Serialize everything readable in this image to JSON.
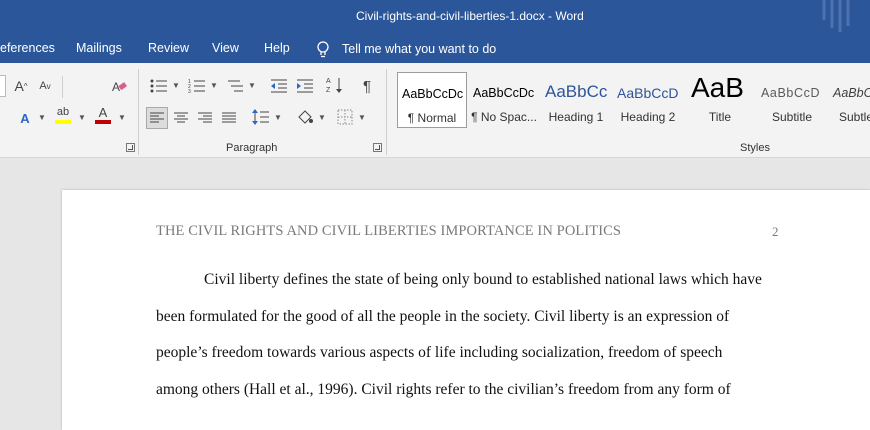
{
  "window": {
    "title": "Civil-rights-and-civil-liberties-1.docx  -  Word"
  },
  "menu": {
    "items": [
      {
        "label": "eferences"
      },
      {
        "label": "Mailings"
      },
      {
        "label": "Review"
      },
      {
        "label": "View"
      },
      {
        "label": "Help"
      }
    ],
    "tell_me": "Tell me what you want to do"
  },
  "ribbon": {
    "groups": {
      "paragraph": "Paragraph",
      "styles": "Styles"
    },
    "icons": {
      "grow_font": "A",
      "shrink_font": "A",
      "clear_formatting": "eraser-icon",
      "text_effects": "A",
      "highlight": "ab",
      "font_color": "A",
      "pilcrow": "¶",
      "sort": "A↓Z"
    },
    "colors": {
      "highlight": "#ffff00",
      "font_color": "#c00000",
      "brand": "#2b579a"
    }
  },
  "styles": [
    {
      "preview": "AaBbCcDc",
      "name": "¶ Normal",
      "selected": true
    },
    {
      "preview": "AaBbCcDc",
      "name": "¶ No Spac..."
    },
    {
      "preview": "AaBbCc",
      "name": "Heading 1"
    },
    {
      "preview": "AaBbCcD",
      "name": "Heading 2"
    },
    {
      "preview": "AaB",
      "name": "Title"
    },
    {
      "preview": "AaBbCcD",
      "name": "Subtitle"
    },
    {
      "preview": "AaBbC",
      "name": "Subtle"
    }
  ],
  "document": {
    "running_head": "THE CIVIL RIGHTS AND CIVIL LIBERTIES IMPORTANCE IN POLITICS",
    "page_number": "2",
    "lines": [
      "Civil liberty defines the state of being only bound to established national laws which have",
      "been formulated for the good of all the people in the society. Civil liberty is an expression of",
      "people’s freedom towards various aspects of life including socialization, freedom of speech",
      "among others (Hall et al., 1996). Civil rights refer to the civilian’s freedom from any form of"
    ]
  }
}
